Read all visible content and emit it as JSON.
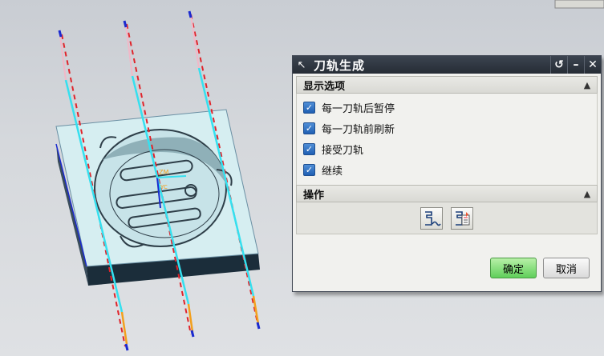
{
  "dialog": {
    "title": "刀轨生成",
    "section_display": "显示选项",
    "options": [
      {
        "label": "每一刀轨后暂停",
        "checked": true
      },
      {
        "label": "每一刀轨前刷新",
        "checked": true
      },
      {
        "label": "接受刀轨",
        "checked": true
      },
      {
        "label": "继续",
        "checked": true
      }
    ],
    "section_ops": "操作",
    "ok_label": "确定",
    "cancel_label": "取消"
  },
  "viewport": {
    "labels": {
      "zm": "ZM",
      "yc": "YC"
    }
  },
  "icons": [
    "pin-icon",
    "reset-icon",
    "minimize-icon",
    "close-icon",
    "collapse-chevron-icon",
    "checkmark-icon",
    "replay-toolpath-icon",
    "list-toolpath-icon"
  ],
  "colors": {
    "path_cyan": "#35e0ef",
    "path_red": "#e0232a",
    "path_orange": "#f2a01e",
    "path_blue": "#1a2ad0",
    "part_top": "#d4eef0",
    "ok_green": "#5fcf5a",
    "titlebar": "#2b313b"
  }
}
